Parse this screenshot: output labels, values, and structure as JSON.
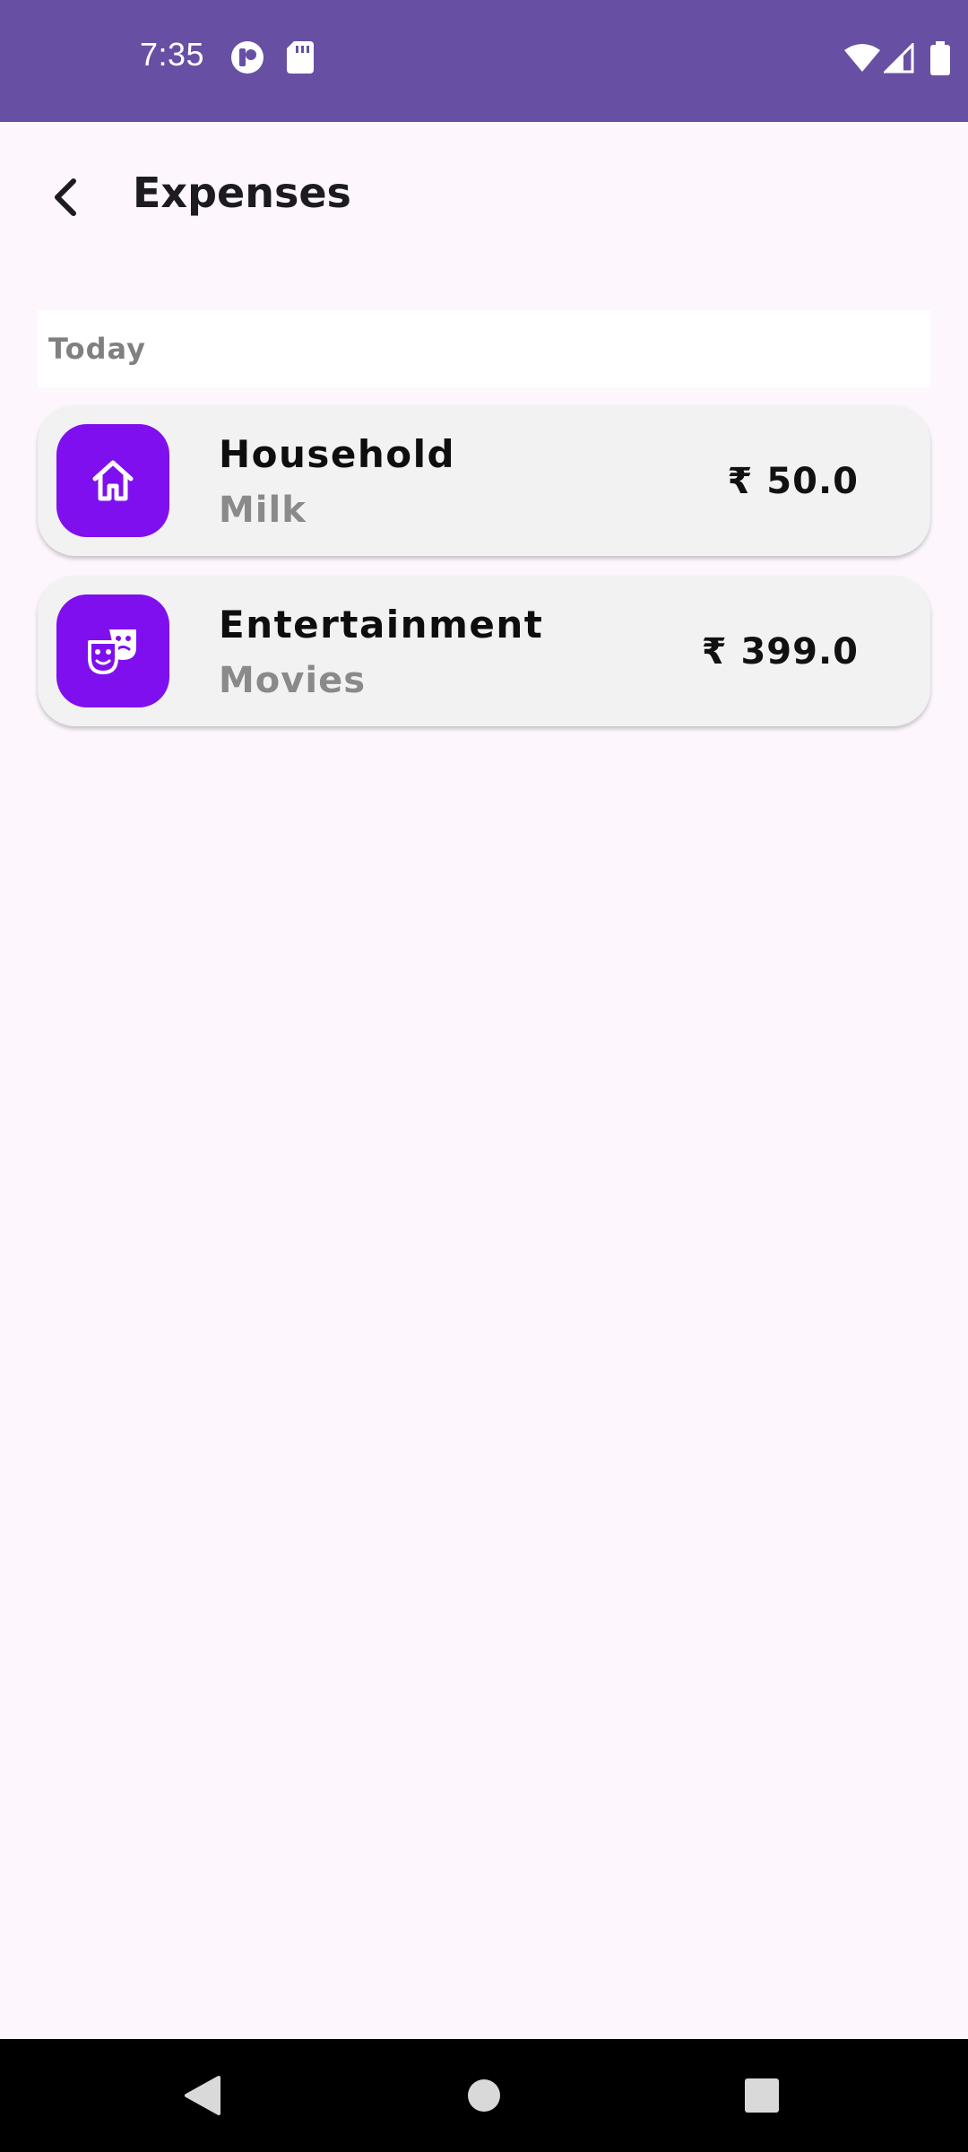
{
  "status_bar": {
    "time": "7:35",
    "icons": [
      "media-session-icon",
      "sd-card-icon",
      "wifi-icon",
      "signal-icon",
      "battery-icon"
    ]
  },
  "app_bar": {
    "title": "Expenses",
    "back_icon": "back-arrow-icon"
  },
  "sections": [
    {
      "label": "Today",
      "items": [
        {
          "category": "Household",
          "note": "Milk",
          "amount": "₹ 50.0",
          "icon": "home-icon",
          "icon_color": "#7f0fef"
        },
        {
          "category": "Entertainment",
          "note": "Movies",
          "amount": "₹ 399.0",
          "icon": "theater-masks-icon",
          "icon_color": "#7f0fef"
        }
      ]
    }
  ],
  "nav_bar": {
    "icons": [
      "back-triangle-icon",
      "home-circle-icon",
      "recents-square-icon"
    ]
  },
  "colors": {
    "status_bar": "#6750a4",
    "background": "#fdf7fd",
    "card": "#f2f2f2",
    "accent": "#7f0fef"
  }
}
